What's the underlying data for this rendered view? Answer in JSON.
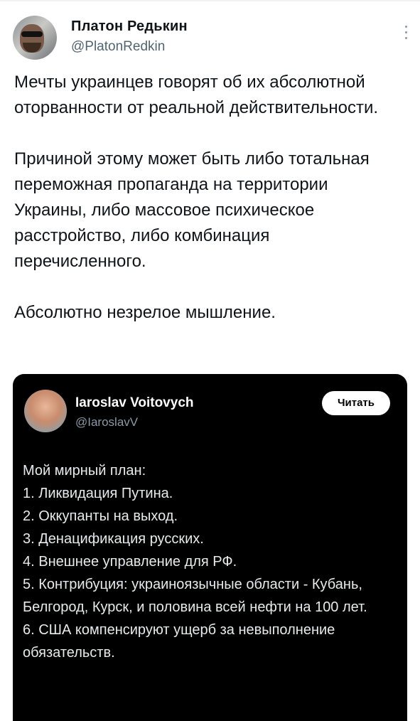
{
  "tweet": {
    "author_name": "Платон Редькин",
    "author_handle": "@PlatonRedkin",
    "more_icon": "more-vertical-icon",
    "paragraphs": [
      "Мечты украинцев говорят об их абсолютной оторванности от реальной действительности.",
      "Причиной этому может быть либо тотальная переможная пропаганда на территории Украины, либо массовое психическое расстройство, либо комбинация перечисленного.",
      "Абсолютно незрелое мышление."
    ]
  },
  "quoted": {
    "author_name": "Iaroslav Voitovych",
    "author_handle": "@IaroslavV",
    "read_button": "Читать",
    "lines": [
      "Мой мирный план:",
      "1. Ликвидация Путина.",
      "2. Оккупанты на выход.",
      "3. Денацификация русских.",
      "4. Внешнее управление для РФ.",
      "5. Контрибуция: украиноязычные области - Кубань, Белгород, Курск, и половина всей нефти на 100 лет.",
      "6. США компенсируют ущерб за невыполнение обязательств."
    ]
  },
  "colors": {
    "background": "#ffffff",
    "text": "#0f1419",
    "secondary_text": "#536471",
    "embed_background": "#000000",
    "embed_text": "#e7e9ea"
  }
}
